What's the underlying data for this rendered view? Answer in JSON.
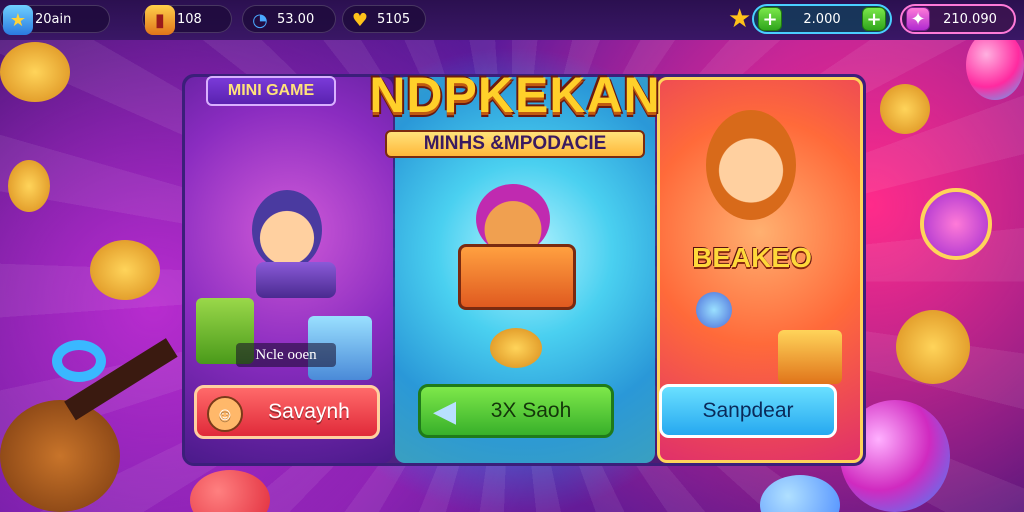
{
  "hud": {
    "left": [
      {
        "icon": "star-icon",
        "value": "20ain"
      },
      {
        "icon": "potion-icon",
        "value": "108"
      },
      {
        "icon": "clock-icon",
        "value": "53.00"
      },
      {
        "icon": "heart-icon",
        "value": "5105"
      }
    ],
    "right": [
      {
        "icon": "plus-icon",
        "value": "2.000"
      },
      {
        "icon": "gem-icon",
        "value": "210.090"
      }
    ]
  },
  "panel": {
    "tag": "MINI GAME",
    "title": "NDPKEKAN",
    "subtitle": "MINHS &MPODACIE",
    "card3_label": "BEAKEO",
    "card1_caption": "Ncle ooen",
    "buttons": [
      {
        "label": "Savaynh",
        "icon": "acorn-face-icon"
      },
      {
        "label": "3X Saoh",
        "icon": "triangle-icon"
      },
      {
        "label": "Sanpdear",
        "icon": ""
      }
    ]
  },
  "colors": {
    "accent_gold": "#ffd02a",
    "button_red": "#e02a3a",
    "button_green": "#38b02a",
    "button_blue": "#26a8f0"
  }
}
